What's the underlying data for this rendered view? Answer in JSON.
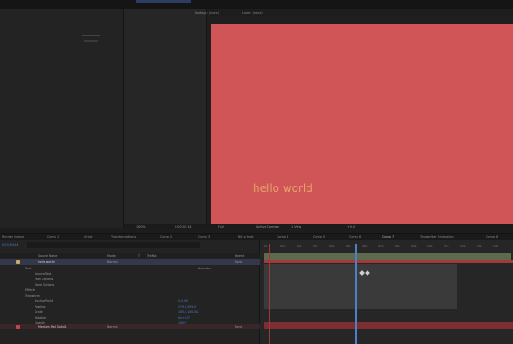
{
  "top": {
    "viewer_tab_left": "Footage: (none)",
    "viewer_tab_right": "Layer: (none)"
  },
  "viewer": {
    "canvas_text": "hello world",
    "zoom": "100%",
    "timecode": "0;00;03;14",
    "resolution": "Full",
    "camera": "Active Camera",
    "views": "1 View",
    "offset": "+0.0"
  },
  "timeline_tabs": [
    "Render Queue",
    "Comp 1",
    "Circle",
    "Transformations",
    "Comp 2",
    "Comp 3",
    "Bit of text",
    "Comp 4",
    "Comp 5",
    "Comp 6",
    "Comp 7",
    "Typewriter_Animation",
    "Comp 8"
  ],
  "timeline": {
    "current_time": "0;00;03;14",
    "columns": [
      "Source Name",
      "Mode",
      "T",
      "TrkMat",
      "Parent"
    ],
    "layers": [
      {
        "name": "hello world",
        "mode": "Normal",
        "parent": "None"
      },
      {
        "name": "Text",
        "mode": "",
        "parent": ""
      },
      {
        "name": "Source Text",
        "mode": "",
        "parent": ""
      },
      {
        "name": "Path Options",
        "mode": "",
        "parent": ""
      },
      {
        "name": "More Options",
        "mode": "",
        "parent": ""
      },
      {
        "name": "Effects",
        "mode": "",
        "parent": ""
      },
      {
        "name": "Transform",
        "mode": "",
        "parent": ""
      },
      {
        "name": "Anchor Point",
        "mode": "",
        "parent": ""
      },
      {
        "name": "Position",
        "mode": "",
        "parent": ""
      },
      {
        "name": "Scale",
        "mode": "",
        "parent": ""
      },
      {
        "name": "Rotation",
        "mode": "",
        "parent": ""
      },
      {
        "name": "Opacity",
        "mode": "",
        "parent": ""
      },
      {
        "name": "Medium Red Solid 1",
        "mode": "Normal",
        "parent": "None"
      }
    ],
    "values": [
      "0.0,0.0",
      "279.0,259.0",
      "100.0,100.0%",
      "0x+0.0°",
      "100%"
    ],
    "animate_label": "Animate:",
    "ruler": [
      "0s",
      "01s",
      "02s",
      "03s",
      "04s",
      "05s",
      "06s",
      "07s",
      "08s",
      "09s",
      "10s",
      "11s",
      "12s",
      "13s",
      "14s"
    ]
  }
}
